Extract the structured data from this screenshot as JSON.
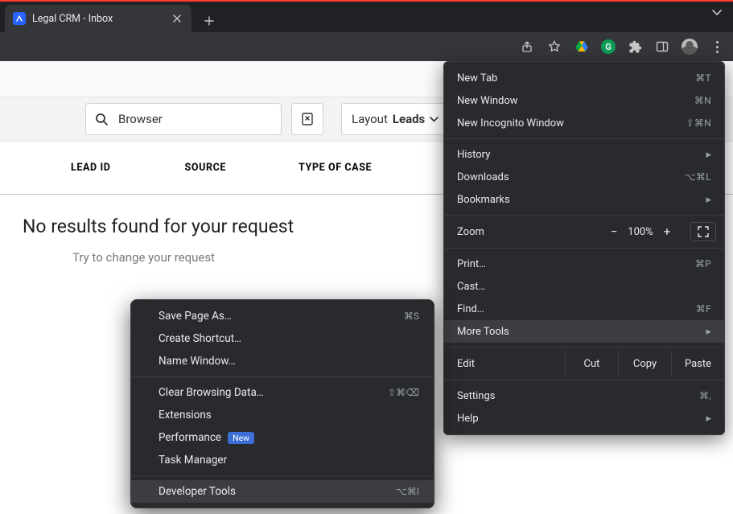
{
  "browser": {
    "tab_title": "Legal CRM - Inbox"
  },
  "app": {
    "search_value": "Browser",
    "layout_label": "Layout",
    "layout_value": "Leads",
    "columns": {
      "lead_id": "LEAD ID",
      "source": "SOURCE",
      "type_of_case": "TYPE OF CASE"
    },
    "empty_title": "No results found for your request",
    "empty_hint": "Try to change your request"
  },
  "menu": {
    "new_tab": "New Tab",
    "new_tab_sc": "⌘T",
    "new_window": "New Window",
    "new_window_sc": "⌘N",
    "new_incognito": "New Incognito Window",
    "new_incognito_sc": "⇧⌘N",
    "history": "History",
    "downloads": "Downloads",
    "downloads_sc": "⌥⌘L",
    "bookmarks": "Bookmarks",
    "zoom": "Zoom",
    "zoom_value": "100%",
    "print": "Print…",
    "print_sc": "⌘P",
    "cast": "Cast…",
    "find": "Find…",
    "find_sc": "⌘F",
    "more_tools": "More Tools",
    "edit": "Edit",
    "cut": "Cut",
    "copy": "Copy",
    "paste": "Paste",
    "settings": "Settings",
    "settings_sc": "⌘,",
    "help": "Help"
  },
  "submenu": {
    "save_page": "Save Page As…",
    "save_page_sc": "⌘S",
    "create_shortcut": "Create Shortcut…",
    "name_window": "Name Window…",
    "clear_browsing": "Clear Browsing Data…",
    "clear_browsing_sc": "⇧⌘⌫",
    "extensions": "Extensions",
    "performance": "Performance",
    "performance_badge": "New",
    "task_manager": "Task Manager",
    "developer_tools": "Developer Tools",
    "developer_tools_sc": "⌥⌘I"
  }
}
